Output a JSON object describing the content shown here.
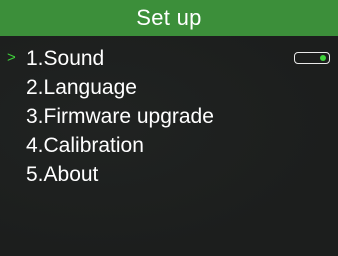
{
  "title": "Set up",
  "cursor_glyph": ">",
  "accent_color": "#3c8f3a",
  "menu": {
    "items": [
      {
        "label": "1.Sound",
        "selected": true,
        "toggle": {
          "on": true
        }
      },
      {
        "label": "2.Language"
      },
      {
        "label": "3.Firmware upgrade"
      },
      {
        "label": "4.Calibration"
      },
      {
        "label": "5.About"
      }
    ]
  }
}
